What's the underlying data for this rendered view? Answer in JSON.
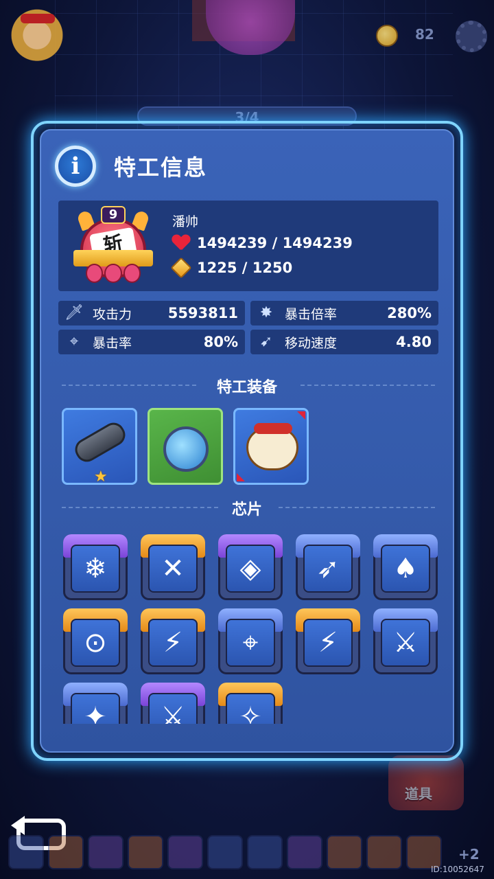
{
  "hud": {
    "coin_count": "82",
    "wave_progress": "3/4",
    "item_button_label": "道具",
    "more_chips": "+2",
    "player_id": "ID:10052647"
  },
  "modal": {
    "title": "特工信息",
    "agent": {
      "emblem_level": "9",
      "emblem_mark": "斩",
      "name": "潘帅",
      "hp": "1494239 / 1494239",
      "energy": "1225 / 1250"
    },
    "stats": [
      {
        "label": "攻击力",
        "value": "5593811",
        "icon": "sword-icon"
      },
      {
        "label": "暴击倍率",
        "value": "280%",
        "icon": "burst-icon"
      },
      {
        "label": "暴击率",
        "value": "80%",
        "icon": "crosshair-icon"
      },
      {
        "label": "移动速度",
        "value": "4.80",
        "icon": "boot-icon"
      }
    ],
    "equipment_title": "特工装备",
    "equipment": [
      {
        "name": "cannon",
        "rarity": "blue",
        "stars": 1
      },
      {
        "name": "bomb",
        "rarity": "green",
        "stars": 0
      },
      {
        "name": "bell-bag",
        "rarity": "blue",
        "stars": 0
      }
    ],
    "chips_title": "芯片",
    "chips": [
      {
        "icon": "snowflake-icon",
        "tier": "purple",
        "glyph": "❄"
      },
      {
        "icon": "cross-swords-icon",
        "tier": "orange",
        "glyph": "✕"
      },
      {
        "icon": "octagon-shield-icon",
        "tier": "purple",
        "glyph": "◈"
      },
      {
        "icon": "dash-strike-icon",
        "tier": "blue",
        "glyph": "➶"
      },
      {
        "icon": "rocket-icon",
        "tier": "blue",
        "glyph": "♠"
      },
      {
        "icon": "target-box-icon",
        "tier": "orange",
        "glyph": "⊙"
      },
      {
        "icon": "lightning-octagon-icon",
        "tier": "orange",
        "glyph": "⚡"
      },
      {
        "icon": "target-base-icon",
        "tier": "blue",
        "glyph": "⌖"
      },
      {
        "icon": "lightning-frame-icon",
        "tier": "orange",
        "glyph": "⚡"
      },
      {
        "icon": "sword-slash-icon",
        "tier": "blue",
        "glyph": "⚔"
      },
      {
        "icon": "lightning-shield-icon",
        "tier": "blue",
        "glyph": "✦"
      },
      {
        "icon": "sword-burst-icon",
        "tier": "purple",
        "glyph": "⚔"
      },
      {
        "icon": "octagon-sword-icon",
        "tier": "orange",
        "glyph": "✧"
      }
    ]
  }
}
